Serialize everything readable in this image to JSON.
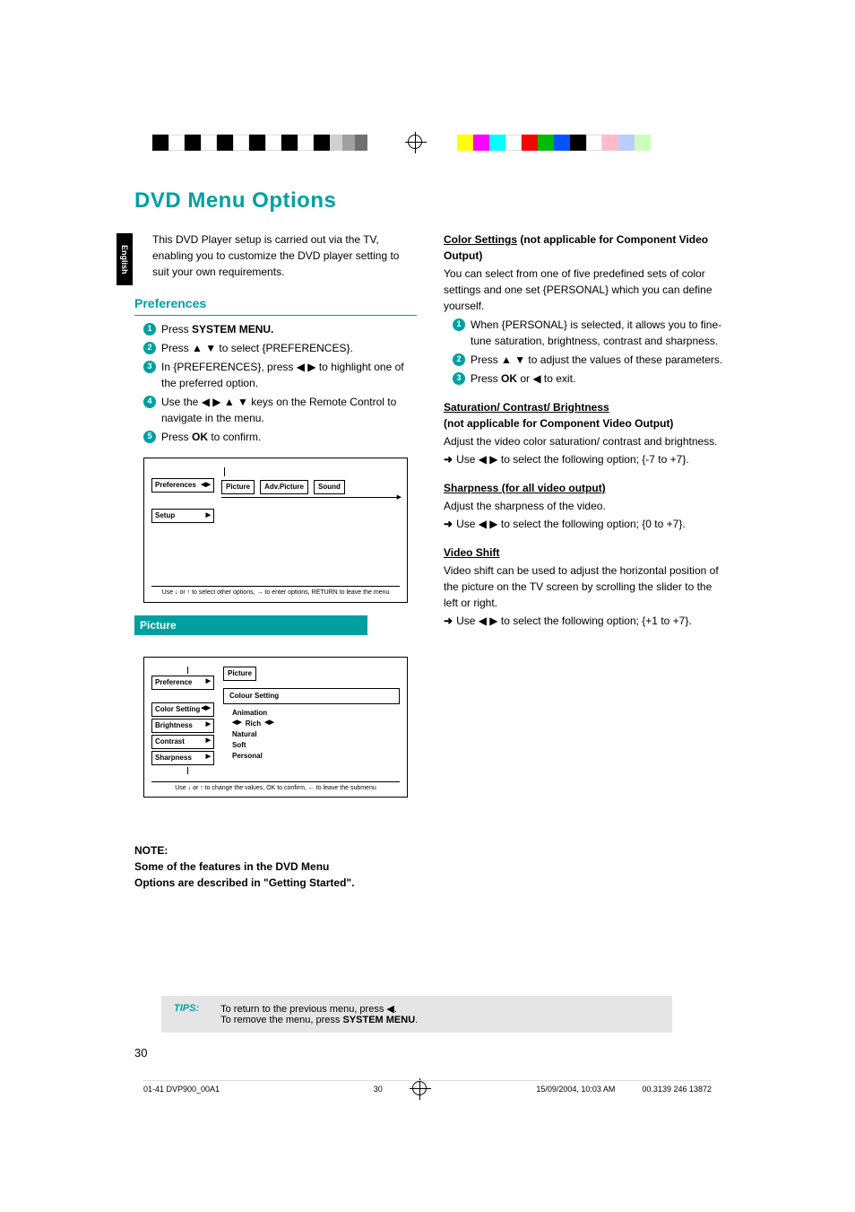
{
  "lang_tab": "English",
  "title": "DVD Menu Options",
  "intro": "This DVD Player setup is carried out via the TV, enabling you to customize the DVD player setting to suit your own requirements.",
  "preferences": {
    "heading": "Preferences",
    "s1a": "Press ",
    "s1b": "SYSTEM MENU.",
    "s2": "Press ▲ ▼ to select {PREFERENCES}.",
    "s3": "In {PREFERENCES}, press ◀ ▶ to highlight one of the preferred option.",
    "s4": "Use the ◀ ▶ ▲ ▼ keys on the Remote Control to navigate in the menu.",
    "s5a": "Press ",
    "s5b": "OK",
    "s5c": " to confirm."
  },
  "osd1": {
    "left1": "Preferences",
    "left2": "Setup",
    "tabs": [
      "Picture",
      "Adv.Picture",
      "Sound"
    ],
    "hint": "Use ↓ or ↑ to select other options, → to enter options, RETURN to leave the menu"
  },
  "picture": {
    "heading": "Picture"
  },
  "osd2": {
    "top": "Picture",
    "left": [
      "Preference",
      "Color Setting",
      "Brightness",
      "Contrast",
      "Sharpness"
    ],
    "righth": "Colour Setting",
    "opts": [
      "Animation",
      "Rich",
      "Natural",
      "Soft",
      "Personal"
    ],
    "hint": "Use ↓ or ↑ to change the values, OK to confirm, ← to leave the submenu"
  },
  "note": {
    "h": "NOTE:",
    "body": "Some of the features in the DVD Menu Options are described in \"Getting Started\"."
  },
  "right": {
    "cs_h": "Color Settings",
    "cs_h2": " (not applicable for Component Video Output)",
    "cs_p": "You can select from one of five predefined sets of color settings and one set {PERSONAL} which you can define yourself.",
    "cs_s1": "When {PERSONAL} is selected, it allows you to fine-tune saturation, brightness, contrast and sharpness.",
    "cs_s2": "Press ▲ ▼ to adjust the values of these parameters.",
    "cs_s3a": "Press ",
    "cs_s3b": "OK",
    "cs_s3c": " or ◀ to exit.",
    "scb_h": "Saturation/ Contrast/ Brightness",
    "scb_h2": "(not applicable for Component Video Output)",
    "scb_p": "Adjust the video color saturation/ contrast and brightness.",
    "scb_u": "Use ◀ ▶ to select the following option; {-7 to +7}.",
    "sh_h": "Sharpness",
    "sh_h2": " (for all video output)",
    "sh_p": "Adjust the sharpness of the video.",
    "sh_u": "Use ◀ ▶ to select the following option; {0 to +7}.",
    "vs_h": "Video Shift",
    "vs_p": "Video shift can be used to adjust the horizontal position of the picture on the TV screen by scrolling the slider to the left or right.",
    "vs_u": "Use ◀ ▶ to select the following option; {+1 to +7}."
  },
  "tips": {
    "label": "TIPS:",
    "l1": "To return to the previous menu, press ◀.",
    "l2a": "To remove the menu, press ",
    "l2b": "SYSTEM MENU",
    "l2c": "."
  },
  "pgnum": "30",
  "footer": {
    "left": "01-41 DVP900_00A1",
    "mid": "30",
    "date": "15/09/2004, 10:03 AM",
    "code": "00.3139 246 13872"
  }
}
